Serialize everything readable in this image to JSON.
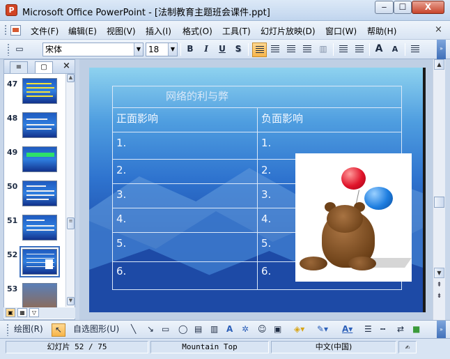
{
  "window": {
    "app_icon": "P",
    "title": "Microsoft Office PowerPoint - [法制教育主题班会课件.ppt]",
    "minimize": "‒",
    "maximize": "☐",
    "close": "X"
  },
  "menu": {
    "items": [
      "文件(F)",
      "编辑(E)",
      "视图(V)",
      "插入(I)",
      "格式(O)",
      "工具(T)",
      "幻灯片放映(D)",
      "窗口(W)",
      "帮助(H)"
    ],
    "close_glyph": "×"
  },
  "format_toolbar": {
    "font": "宋体",
    "size": "18",
    "bold": "B",
    "italic": "I",
    "underline": "U",
    "shadow": "S",
    "grow_font": "A",
    "shrink_font": "A",
    "new_slide": "▭"
  },
  "slide_pane": {
    "tab_outline": "≡",
    "tab_slides": "▢",
    "close": "×",
    "thumbnails": [
      {
        "num": "47"
      },
      {
        "num": "48"
      },
      {
        "num": "49"
      },
      {
        "num": "50"
      },
      {
        "num": "51"
      },
      {
        "num": "52",
        "selected": true
      },
      {
        "num": "53"
      }
    ]
  },
  "slide": {
    "title": "网络的利与弊",
    "headers": [
      "正面影响",
      "负面影响"
    ],
    "rows": [
      [
        "1.",
        "1."
      ],
      [
        "2.",
        "2."
      ],
      [
        "3.",
        "3."
      ],
      [
        "4.",
        "4."
      ],
      [
        "5.",
        "5."
      ],
      [
        "6.",
        "6."
      ]
    ]
  },
  "draw_toolbar": {
    "draw": "绘图(R)",
    "autoshapes": "自选图形(U)"
  },
  "status": {
    "slide_info": "幻灯片 52 / 75",
    "design": "Mountain Top",
    "language": "中文(中国)"
  },
  "colors": {
    "slide_accent": "#2f74cf",
    "titlebar": "#c1d5ee",
    "active_button": "#f7b54a"
  }
}
